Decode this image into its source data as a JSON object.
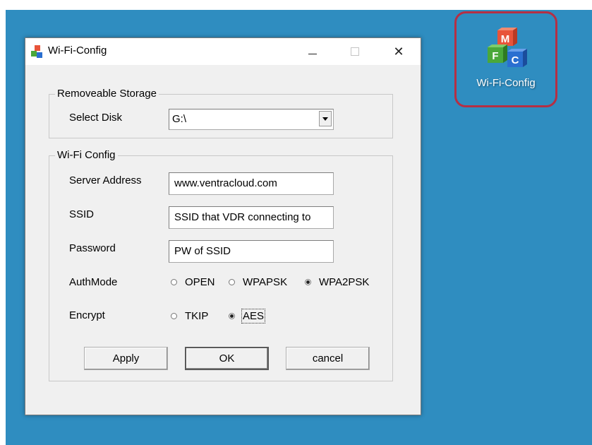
{
  "desktop": {
    "shortcut": {
      "label": "Wi-Fi-Config",
      "icon": "mfc-cubes-icon"
    },
    "colors": {
      "background": "#2f8dc0",
      "highlight_ring": "#b52f44"
    }
  },
  "window": {
    "title": "Wi-Fi-Config",
    "icon": "app-cubes-icon",
    "controls": {
      "minimize": "minimize-icon",
      "maximize": "maximize-icon",
      "close": "close-icon",
      "close_glyph": "✕"
    }
  },
  "removeable_storage": {
    "legend": "Removeable Storage",
    "select_disk_label": "Select Disk",
    "selected_disk": "G:\\"
  },
  "wifi_config": {
    "legend": "Wi-Fi Config",
    "server_address_label": "Server Address",
    "server_address_value": "www.ventracloud.com",
    "ssid_label": "SSID",
    "ssid_value": "SSID that VDR connecting to",
    "password_label": "Password",
    "password_value": "PW of SSID",
    "authmode_label": "AuthMode",
    "authmode_options": [
      "OPEN",
      "WPAPSK",
      "WPA2PSK"
    ],
    "authmode_selected": "WPA2PSK",
    "encrypt_label": "Encrypt",
    "encrypt_options": [
      "TKIP",
      "AES"
    ],
    "encrypt_selected": "AES"
  },
  "buttons": {
    "apply": "Apply",
    "ok": "OK",
    "cancel": "cancel"
  }
}
